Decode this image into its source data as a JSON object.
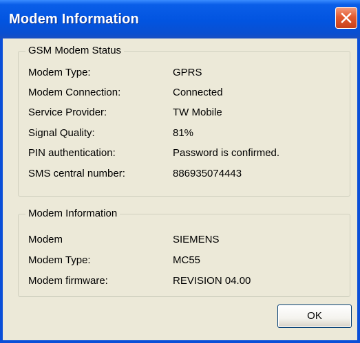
{
  "window": {
    "title": "Modem Information"
  },
  "gsm_status": {
    "group_title": "GSM Modem Status",
    "rows": [
      {
        "label": "Modem Type:",
        "value": "GPRS"
      },
      {
        "label": "Modem Connection:",
        "value": "Connected"
      },
      {
        "label": "Service Provider:",
        "value": "TW Mobile"
      },
      {
        "label": "Signal Quality:",
        "value": "81%"
      },
      {
        "label": "PIN authentication:",
        "value": "Password is confirmed."
      },
      {
        "label": "SMS central number:",
        "value": "886935074443"
      }
    ]
  },
  "modem_info": {
    "group_title": "Modem Information",
    "rows": [
      {
        "label": "Modem",
        "value": "SIEMENS"
      },
      {
        "label": "Modem Type:",
        "value": "MC55"
      },
      {
        "label": "Modem firmware:",
        "value": "REVISION 04.00"
      }
    ]
  },
  "buttons": {
    "ok_label": "OK"
  },
  "icons": {
    "close": "close-x-icon"
  },
  "colors": {
    "titlebar": "#0254e0",
    "close_button": "#e35b30",
    "dialog_background": "#ece9d8"
  }
}
